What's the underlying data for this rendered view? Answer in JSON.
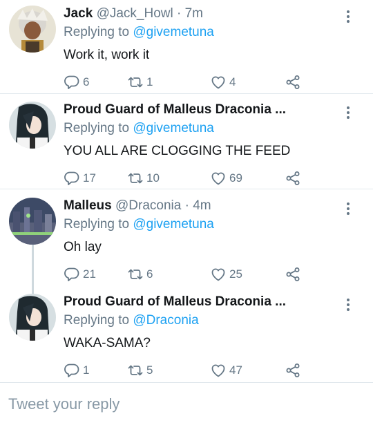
{
  "tweets": [
    {
      "name": "Jack",
      "handle": "@Jack_Howl",
      "time": "· 7m",
      "replying_label": "Replying to",
      "replying_to": "@givemetuna",
      "text": "Work it, work it",
      "replies": "6",
      "retweets": "1",
      "likes": "4"
    },
    {
      "name": "Proud Guard of Malleus Draconia ...",
      "handle": "",
      "time": "",
      "replying_label": "Replying to",
      "replying_to": "@givemetuna",
      "text": "YOU ALL ARE CLOGGING THE FEED",
      "replies": "17",
      "retweets": "10",
      "likes": "69"
    },
    {
      "name": "Malleus",
      "handle": "@Draconia",
      "time": "· 4m",
      "replying_label": "Replying to",
      "replying_to": "@givemetuna",
      "text": "Oh lay",
      "replies": "21",
      "retweets": "6",
      "likes": "25"
    },
    {
      "name": "Proud Guard of Malleus Draconia ...",
      "handle": "",
      "time": "",
      "replying_label": "Replying to",
      "replying_to": "@Draconia",
      "text": "WAKA-SAMA?",
      "replies": "1",
      "retweets": "5",
      "likes": "47"
    }
  ],
  "reply_box": {
    "placeholder": "Tweet your reply"
  },
  "colors": {
    "accent": "#1da1f2",
    "secondary_text": "#657786",
    "divider": "#e1e8ed"
  },
  "icons": [
    "reply-icon",
    "retweet-icon",
    "like-icon",
    "share-icon",
    "more-options-icon"
  ]
}
